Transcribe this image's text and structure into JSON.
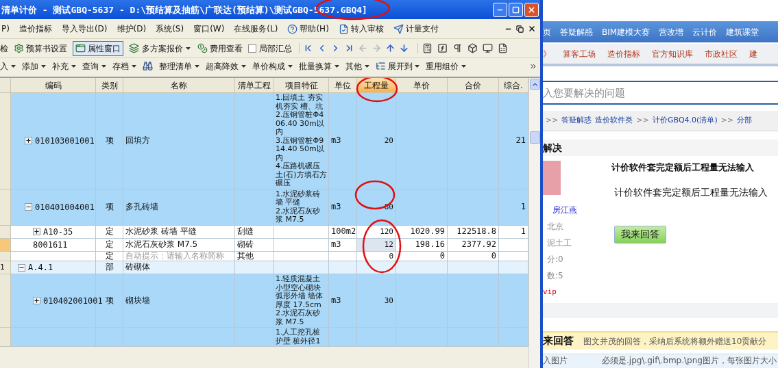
{
  "window": {
    "title": "清单计价 - 测试GBQ-5637 - D:\\预结算及抽筋\\广联达(预结算)\\测试GBQ-5637.GBQ4]"
  },
  "menu": [
    {
      "kind": "text",
      "label": "P)"
    },
    {
      "kind": "text",
      "label": "造价指标"
    },
    {
      "kind": "text",
      "label": "导入导出(D)"
    },
    {
      "kind": "text",
      "label": "维护(D)"
    },
    {
      "kind": "text",
      "label": "系统(S)"
    },
    {
      "kind": "text",
      "label": "窗口(W)"
    },
    {
      "kind": "text",
      "label": "在线服务(L)"
    },
    {
      "kind": "icon-text",
      "label": "帮助(H)"
    },
    {
      "kind": "icon-text",
      "label": "转入审核"
    },
    {
      "kind": "icon-text",
      "label": "计量支付"
    }
  ],
  "toolbar": [
    {
      "kind": "text",
      "label": "检"
    },
    {
      "kind": "button",
      "label": "预算书设置"
    },
    {
      "kind": "toggle",
      "label": "属性窗口",
      "selected": true
    },
    {
      "kind": "dropdown",
      "label": "多方案报价"
    },
    {
      "kind": "button",
      "label": "费用查看"
    },
    {
      "kind": "checkbox",
      "label": "局部汇总",
      "checked": false
    }
  ],
  "nav_icons": [
    {
      "disabled": false
    },
    {
      "disabled": false
    },
    {
      "disabled": false
    },
    {
      "disabled": false
    },
    {
      "disabled": true
    },
    {
      "disabled": true
    },
    {
      "disabled": false
    },
    {
      "disabled": false
    }
  ],
  "toolbar2": [
    {
      "kind": "dropdown",
      "label": "入"
    },
    {
      "kind": "dropdown",
      "label": "添加"
    },
    {
      "kind": "dropdown",
      "label": "补充"
    },
    {
      "kind": "dropdown",
      "label": "查询"
    },
    {
      "kind": "dropdown",
      "label": "存档"
    },
    {
      "kind": "icon"
    },
    {
      "kind": "dropdown",
      "label": "整理清单"
    },
    {
      "kind": "dropdown",
      "label": "超高降效"
    },
    {
      "kind": "dropdown",
      "label": "单价构成"
    },
    {
      "kind": "dropdown",
      "label": "批量换算"
    },
    {
      "kind": "dropdown",
      "label": "其他"
    },
    {
      "kind": "icon-dropdown",
      "label": "展开到"
    },
    {
      "kind": "dropdown",
      "label": "重用组价"
    }
  ],
  "table": {
    "columns": [
      {
        "label": "编码",
        "selected": false
      },
      {
        "label": "类别",
        "selected": false
      },
      {
        "label": "名称",
        "selected": false
      },
      {
        "label": "清单工程",
        "selected": false
      },
      {
        "label": "项目特征",
        "selected": false
      },
      {
        "label": "单位",
        "selected": false
      },
      {
        "label": "工程量",
        "selected": true
      },
      {
        "label": "单价",
        "selected": false
      },
      {
        "label": "合价",
        "selected": false
      },
      {
        "label": "综合.",
        "selected": false
      }
    ],
    "rows": [
      {
        "kind": "item",
        "expanded": false,
        "selected": false,
        "code": "010103001001",
        "type": "项",
        "name": "回填方",
        "features": [
          "1.回填土 夯实机夯实 槽、坑",
          "2.压钢管桩Φ406.40 30m以内",
          "3.压钢管桩Φ914.40 50m以内",
          "4.压路机碾压土(石)方填石方碾压"
        ],
        "unit": "m3",
        "quantity": "20",
        "composite": "21"
      },
      {
        "kind": "item",
        "expanded": true,
        "selected": false,
        "code": "010401004001",
        "type": "项",
        "name": "多孔砖墙",
        "features": [
          "1.水泥砂浆砖墙 平缝",
          "2.水泥石灰砂浆 M7.5"
        ],
        "unit": "m3",
        "quantity": "80",
        "composite": "1",
        "children": [
          {
            "kind": "quota",
            "expanded": false,
            "selected": false,
            "code": "A10-35",
            "type": "定",
            "name": "水泥砂浆 砖墙 平缝",
            "list_project": "刮缝",
            "unit": "100m2",
            "quantity": "120",
            "unit_price": "1020.99",
            "total": "122518.8",
            "composite": "1"
          },
          {
            "kind": "quota",
            "selected": true,
            "code": "8001611",
            "type": "定",
            "name": "水泥石灰砂浆 M7.5",
            "list_project": "砌砖",
            "unit": "m3",
            "quantity": "12",
            "unit_price": "198.16",
            "total": "2377.92"
          },
          {
            "kind": "quota",
            "selected": false,
            "type": "定",
            "name_placeholder": "自动提示：请输入名称简称",
            "list_project": "其他",
            "quantity": "0",
            "unit_price": "0",
            "total": "0"
          }
        ]
      },
      {
        "kind": "section",
        "expanded": true,
        "selected": false,
        "row_number": "1",
        "code": "A.4.1",
        "type": "部",
        "name": "砖砌体",
        "children": [
          {
            "kind": "item",
            "expanded": false,
            "selected": false,
            "code": "010402001001",
            "type": "项",
            "name": "砌块墙",
            "features": [
              "1.轻质混凝土小型空心砌块弧形外墙 墙体厚度 17.5cm",
              "2.水泥石灰砂浆 M7.5"
            ],
            "unit": "m3",
            "quantity": "30"
          },
          {
            "kind": "item",
            "selected": false,
            "features": [
              "1.人工挖孔桩护壁 桩外径1"
            ]
          }
        ]
      }
    ]
  },
  "web": {
    "nav": [
      "页",
      "答疑解惑",
      "BIM建模大赛",
      "营改增",
      "云计价",
      "建筑课堂"
    ],
    "subnav": [
      "》",
      "算客工场",
      "造价指标",
      "官方知识库",
      "市政社区",
      "建"
    ],
    "search": {
      "placeholder": "入您要解决的问题"
    },
    "breadcrumb": [
      {
        "kind": "sep",
        "label": ">>"
      },
      {
        "kind": "link",
        "label": "答疑解惑"
      },
      {
        "kind": "link",
        "label": "造价软件类"
      },
      {
        "kind": "sep",
        "label": ">>"
      },
      {
        "kind": "link",
        "label": "计价GBQ4.0(清单)"
      },
      {
        "kind": "sep",
        "label": ">>"
      },
      {
        "kind": "link",
        "label": "分部"
      }
    ],
    "section_title": "解决",
    "question_title": "计价软件套完定额后工程量无法输入",
    "question_body": "计价软件套完定额后工程量无法输入",
    "user": {
      "name": "房江燕",
      "lines": [
        "北京",
        "泥土工",
        "分:0",
        "数:5"
      ],
      "badge": "vip"
    },
    "answer_button": "我来回答",
    "answer_heading": "来回答",
    "answer_note": "图文并茂的回答，采纳后系统将额外赠送10贡献分",
    "upload_label": "入图片",
    "upload_note": "必须是.jpg\\.gif\\.bmp.\\png图片，每张图片大小"
  }
}
